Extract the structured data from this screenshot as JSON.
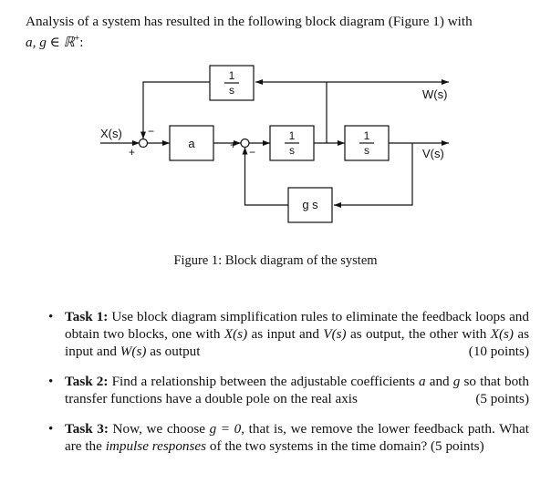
{
  "intro": {
    "text": "Analysis of a system has resulted in the following block diagram (Figure 1) with",
    "math": "a, g ∈ ℝ",
    "sup": "+",
    "tail": ":"
  },
  "diagram": {
    "blocks": {
      "top_integrator": {
        "num": "1",
        "den": "s"
      },
      "gain_a": {
        "label": "a"
      },
      "integrator_1": {
        "num": "1",
        "den": "s"
      },
      "integrator_2": {
        "num": "1",
        "den": "s"
      },
      "feedback_gs": {
        "label": "g s"
      }
    },
    "signals": {
      "input": "X(s)",
      "output_w": "W(s)",
      "output_v": "V(s)"
    },
    "signs": {
      "sum1_plus": "+",
      "sum1_minus": "−",
      "sum2_plus": "+",
      "sum2_minus": "−"
    }
  },
  "caption": "Figure 1:  Block diagram of the system",
  "tasks": [
    {
      "label": "Task 1:",
      "parts": [
        " Use block diagram simplification rules to eliminate the feedback loops and obtain two blocks, one with ",
        "X(s)",
        " as input and ",
        "V(s)",
        " as output, the other with ",
        "X(s)",
        " as input and ",
        "W(s)",
        " as output"
      ],
      "points": "(10 points)"
    },
    {
      "label": "Task 2:",
      "parts": [
        " Find a relationship between the adjustable coefficients ",
        "a",
        " and ",
        "g",
        " so that both transfer functions have a double pole on the real axis"
      ],
      "points": "(5 points)"
    },
    {
      "label": "Task 3:",
      "parts": [
        " Now, we choose ",
        "g = 0",
        ", that is, we remove the lower feedback path. What are the ",
        "impulse responses",
        " of the two systems in the time domain?"
      ],
      "points": "(5 points)"
    }
  ]
}
